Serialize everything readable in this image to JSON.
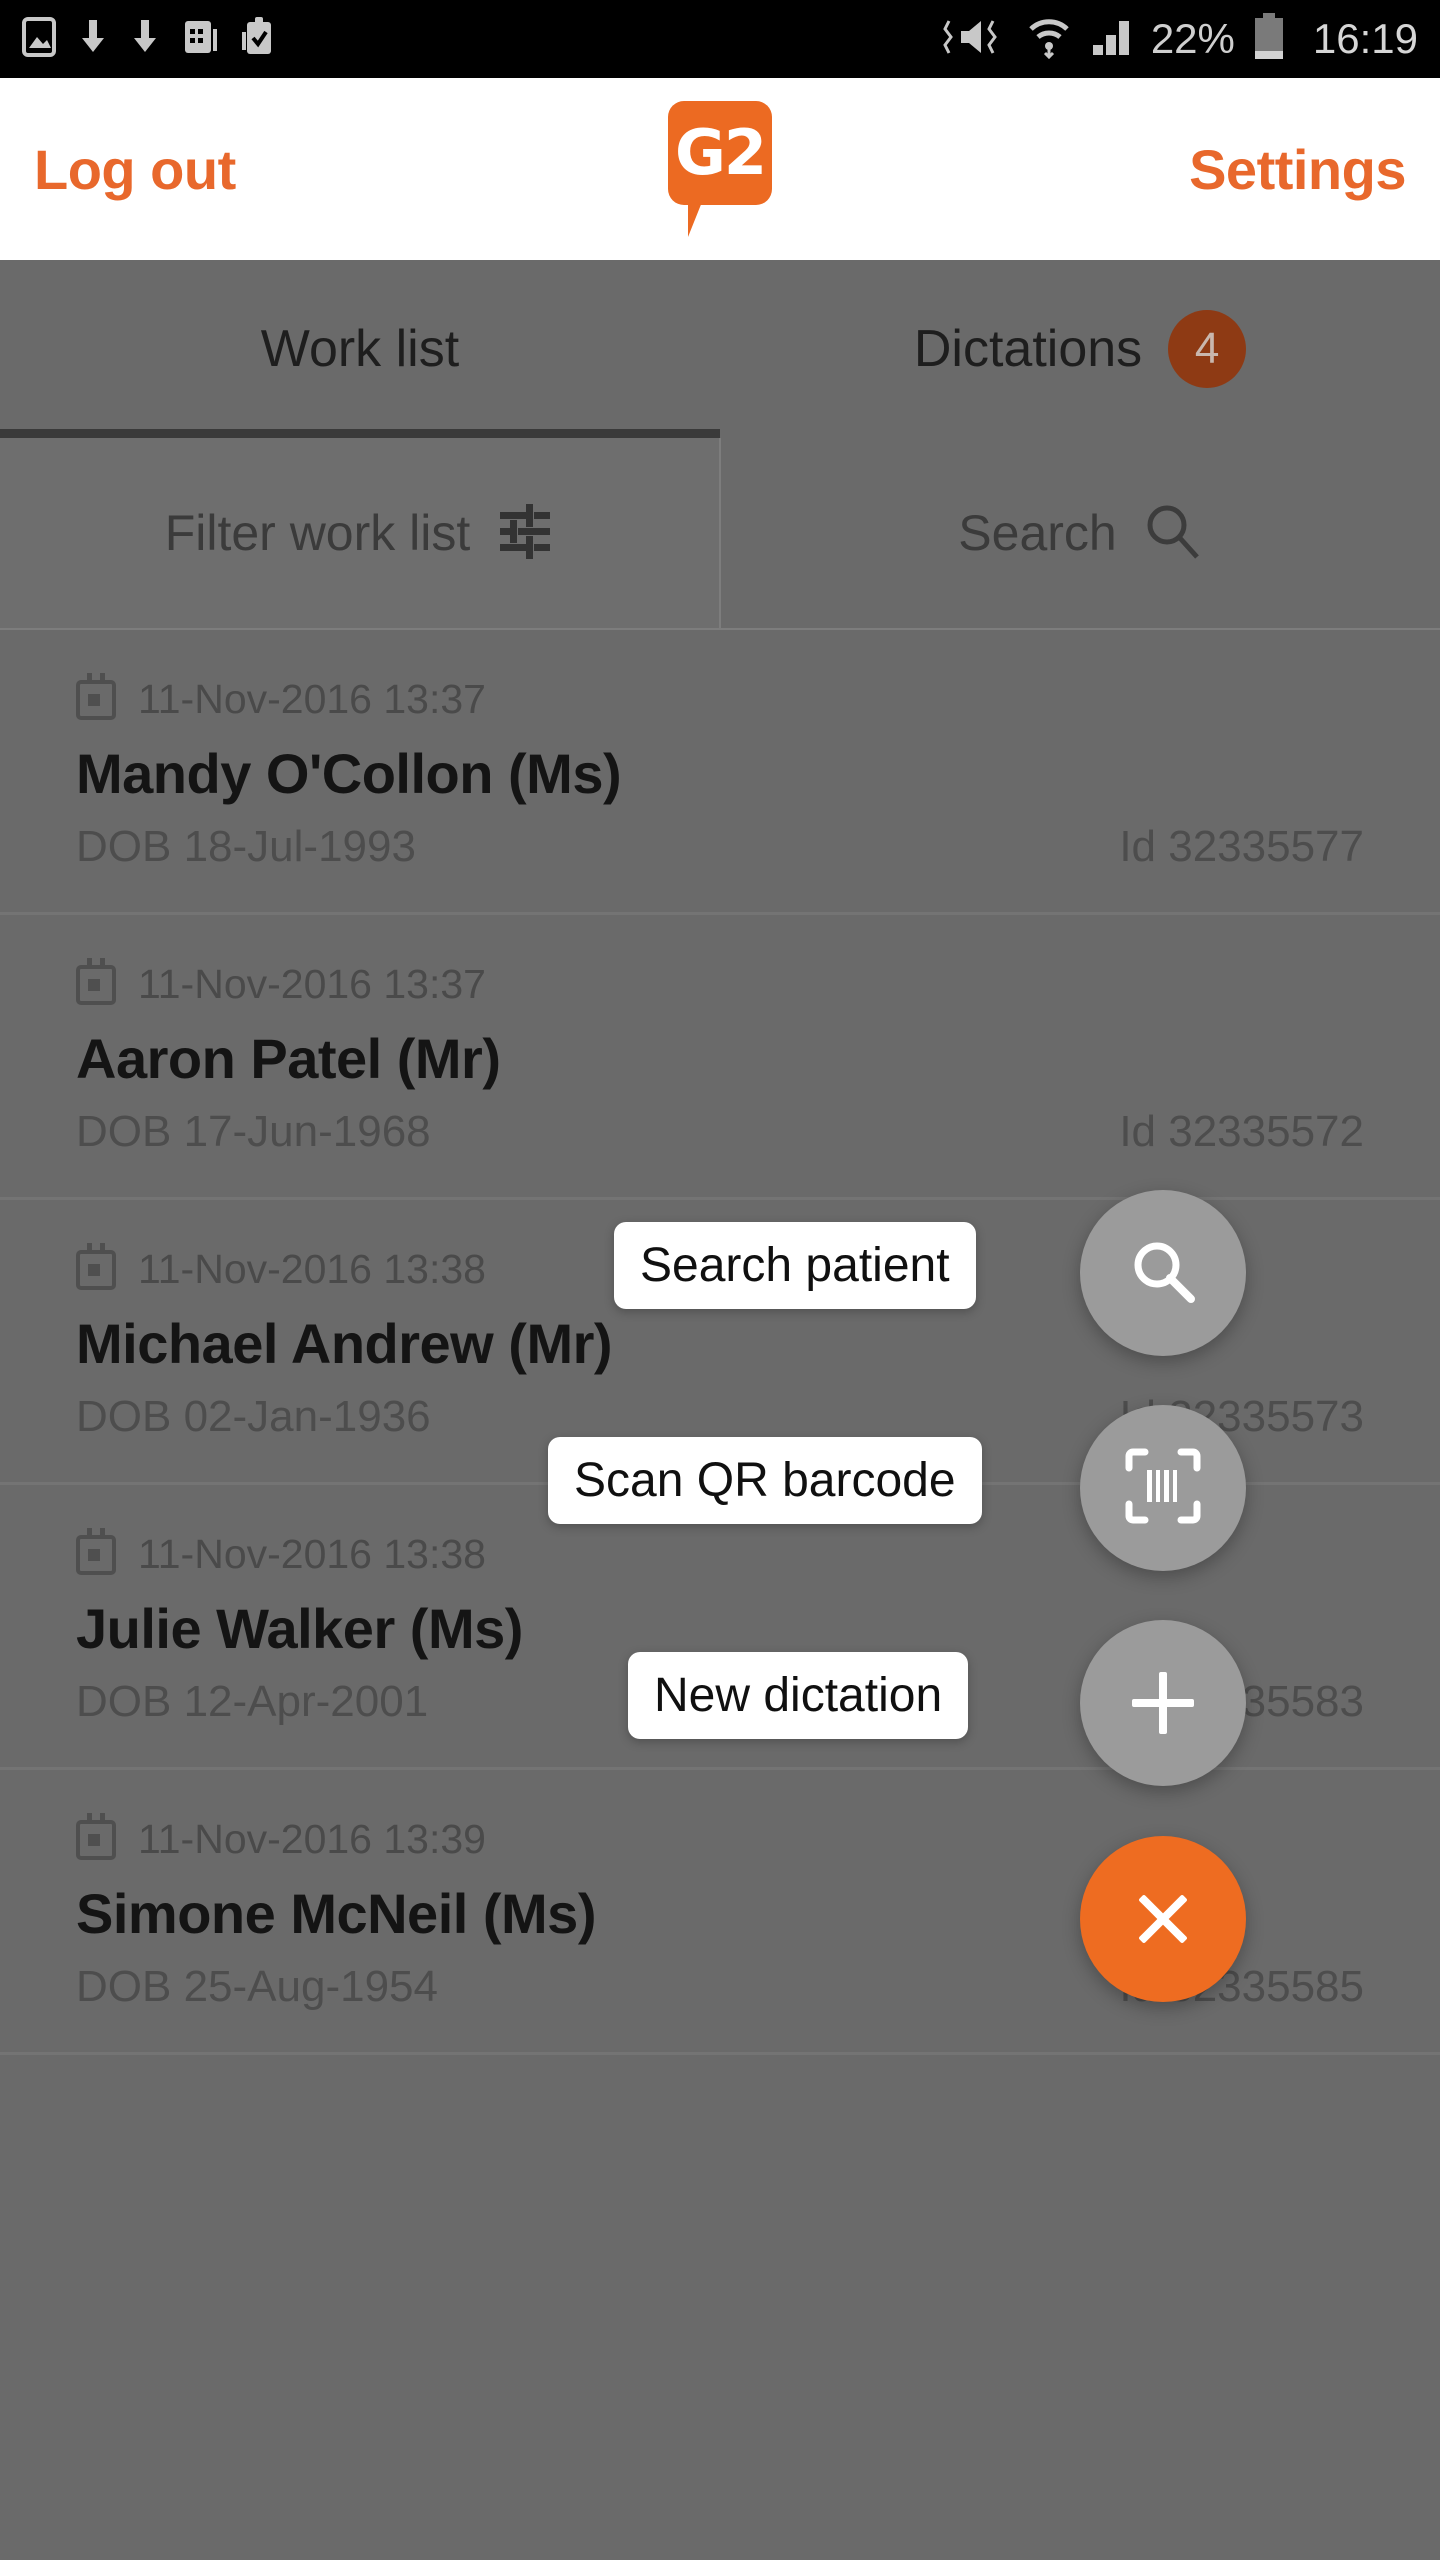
{
  "status_bar": {
    "left_icons": [
      "image-icon",
      "download-icon",
      "download-icon",
      "calendar-app-icon",
      "clipboard-check-icon"
    ],
    "right_icons": [
      "vibrate-mute-icon",
      "wifi-icon",
      "cellular-signal-icon",
      "battery-icon"
    ],
    "battery_percent": "22%",
    "clock": "16:19"
  },
  "header": {
    "logout_label": "Log out",
    "settings_label": "Settings",
    "logo_text": "G2",
    "brand_color": "#ec6a22"
  },
  "tabs": [
    {
      "label": "Work list",
      "badge": "",
      "active": true
    },
    {
      "label": "Dictations",
      "badge": "4",
      "active": false
    }
  ],
  "toolbar": {
    "filter_label": "Filter work list",
    "filter_icon": "sliders-icon",
    "search_label": "Search",
    "search_icon": "magnifier-icon"
  },
  "work_list": [
    {
      "date": "11-Nov-2016 13:37",
      "name": "Mandy O'Collon (Ms)",
      "dob": "DOB 18-Jul-1993",
      "id": "Id 32335577"
    },
    {
      "date": "11-Nov-2016 13:37",
      "name": "Aaron Patel (Mr)",
      "dob": "DOB 17-Jun-1968",
      "id": "Id 32335572"
    },
    {
      "date": "11-Nov-2016 13:38",
      "name": "Michael Andrew (Mr)",
      "dob": "DOB 02-Jan-1936",
      "id": "Id 32335573"
    },
    {
      "date": "11-Nov-2016 13:38",
      "name": "Julie Walker (Ms)",
      "dob": "DOB 12-Apr-2001",
      "id": "Id 32335583"
    },
    {
      "date": "11-Nov-2016 13:39",
      "name": "Simone McNeil (Ms)",
      "dob": "DOB 25-Aug-1954",
      "id": "Id 32335585"
    }
  ],
  "speed_dial": {
    "expanded": true,
    "actions": [
      {
        "tooltip": "Search patient",
        "icon": "magnifier-icon",
        "color": "#9b9b9b"
      },
      {
        "tooltip": "Scan QR barcode",
        "icon": "barcode-scan-icon",
        "color": "#9b9b9b"
      },
      {
        "tooltip": "New dictation",
        "icon": "plus-icon",
        "color": "#9b9b9b"
      }
    ],
    "close": {
      "icon": "close-icon",
      "color": "#ee6c21"
    }
  }
}
